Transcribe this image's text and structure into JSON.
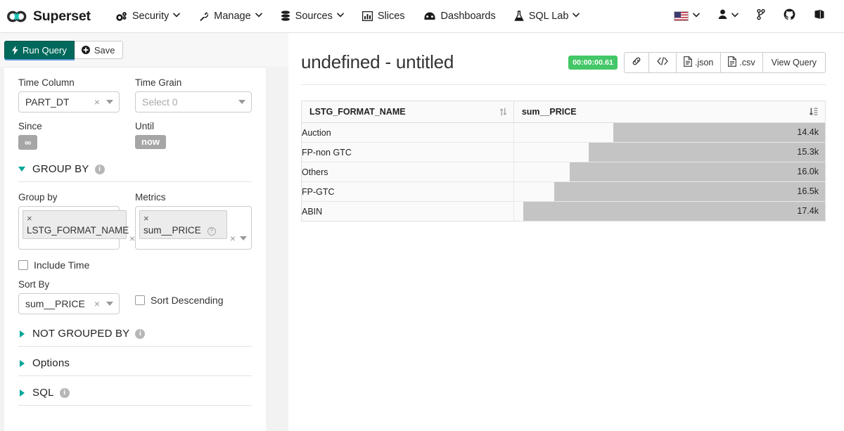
{
  "navbar": {
    "brand": "Superset",
    "brand_logo_icon": "infinity-logo-icon",
    "items": [
      {
        "label": "Security",
        "icon": "gears-icon",
        "caret": "⌄"
      },
      {
        "label": "Manage",
        "icon": "wrench-icon",
        "caret": "⌄"
      },
      {
        "label": "Sources",
        "icon": "database-icon",
        "caret": "⌄"
      },
      {
        "label": "Slices",
        "icon": "bar-chart-icon",
        "caret": ""
      },
      {
        "label": "Dashboards",
        "icon": "dashboard-icon",
        "caret": ""
      },
      {
        "label": "SQL Lab",
        "icon": "flask-icon",
        "caret": "⌄"
      }
    ],
    "right_items": [
      {
        "name": "language-flag",
        "icon": "us-flag-icon",
        "caret": "⌄"
      },
      {
        "name": "user-menu",
        "icon": "user-icon",
        "caret": "⌄"
      },
      {
        "name": "version-link",
        "icon": "git-branch-icon",
        "caret": ""
      },
      {
        "name": "github-link",
        "icon": "github-icon",
        "caret": ""
      },
      {
        "name": "docs-link",
        "icon": "book-icon",
        "caret": ""
      }
    ]
  },
  "controls": {
    "run_query_label": "Run Query",
    "save_label": "Save",
    "time_column": {
      "label": "Time Column",
      "value": "PART_DT"
    },
    "time_grain": {
      "label": "Time Grain",
      "placeholder": "Select 0",
      "value": ""
    },
    "since": {
      "label": "Since",
      "value": "∞"
    },
    "until": {
      "label": "Until",
      "value": "now"
    },
    "group_by_section": {
      "title": "GROUP BY",
      "expanded": true,
      "group_by": {
        "label": "Group by",
        "tokens": [
          "LSTG_FORMAT_NAME"
        ]
      },
      "metrics": {
        "label": "Metrics",
        "tokens": [
          "sum__PRICE"
        ]
      },
      "include_time": {
        "label": "Include Time",
        "checked": false
      },
      "sort_by": {
        "label": "Sort By",
        "value": "sum__PRICE"
      },
      "sort_descending": {
        "label": "Sort Descending",
        "checked": false
      }
    },
    "sections": [
      {
        "title": "NOT GROUPED BY",
        "has_info": true
      },
      {
        "title": "Options",
        "has_info": false
      },
      {
        "title": "SQL",
        "has_info": true
      }
    ]
  },
  "result": {
    "title": "undefined - untitled",
    "timer": "00:00:00.61",
    "actions": [
      {
        "name": "share-link-button",
        "icon": "link-icon",
        "label": ""
      },
      {
        "name": "embed-code-button",
        "icon": "code-icon",
        "label": ""
      },
      {
        "name": "export-json-button",
        "icon": "file-json-icon",
        "label": ".json"
      },
      {
        "name": "export-csv-button",
        "icon": "file-csv-icon",
        "label": ".csv"
      },
      {
        "name": "view-query-button",
        "icon": "",
        "label": "View Query"
      }
    ]
  },
  "chart_data": {
    "type": "table",
    "title": "undefined - untitled",
    "columns": [
      {
        "key": "LSTG_FORMAT_NAME",
        "label": "LSTG_FORMAT_NAME",
        "sort": "none"
      },
      {
        "key": "sum__PRICE",
        "label": "sum__PRICE",
        "sort": "desc-numeric"
      }
    ],
    "categories": [
      "Auction",
      "FP-non GTC",
      "Others",
      "FP-GTC",
      "ABIN"
    ],
    "values": [
      14400,
      15300,
      16000,
      16500,
      17400
    ],
    "value_labels": [
      "14.4k",
      "15.3k",
      "16.0k",
      "16.5k",
      "17.4k"
    ],
    "bar_pct": [
      68,
      76,
      82,
      87,
      97
    ],
    "bar_color": "#c4c4c4",
    "xlabel": "",
    "ylabel": "sum__PRICE"
  }
}
